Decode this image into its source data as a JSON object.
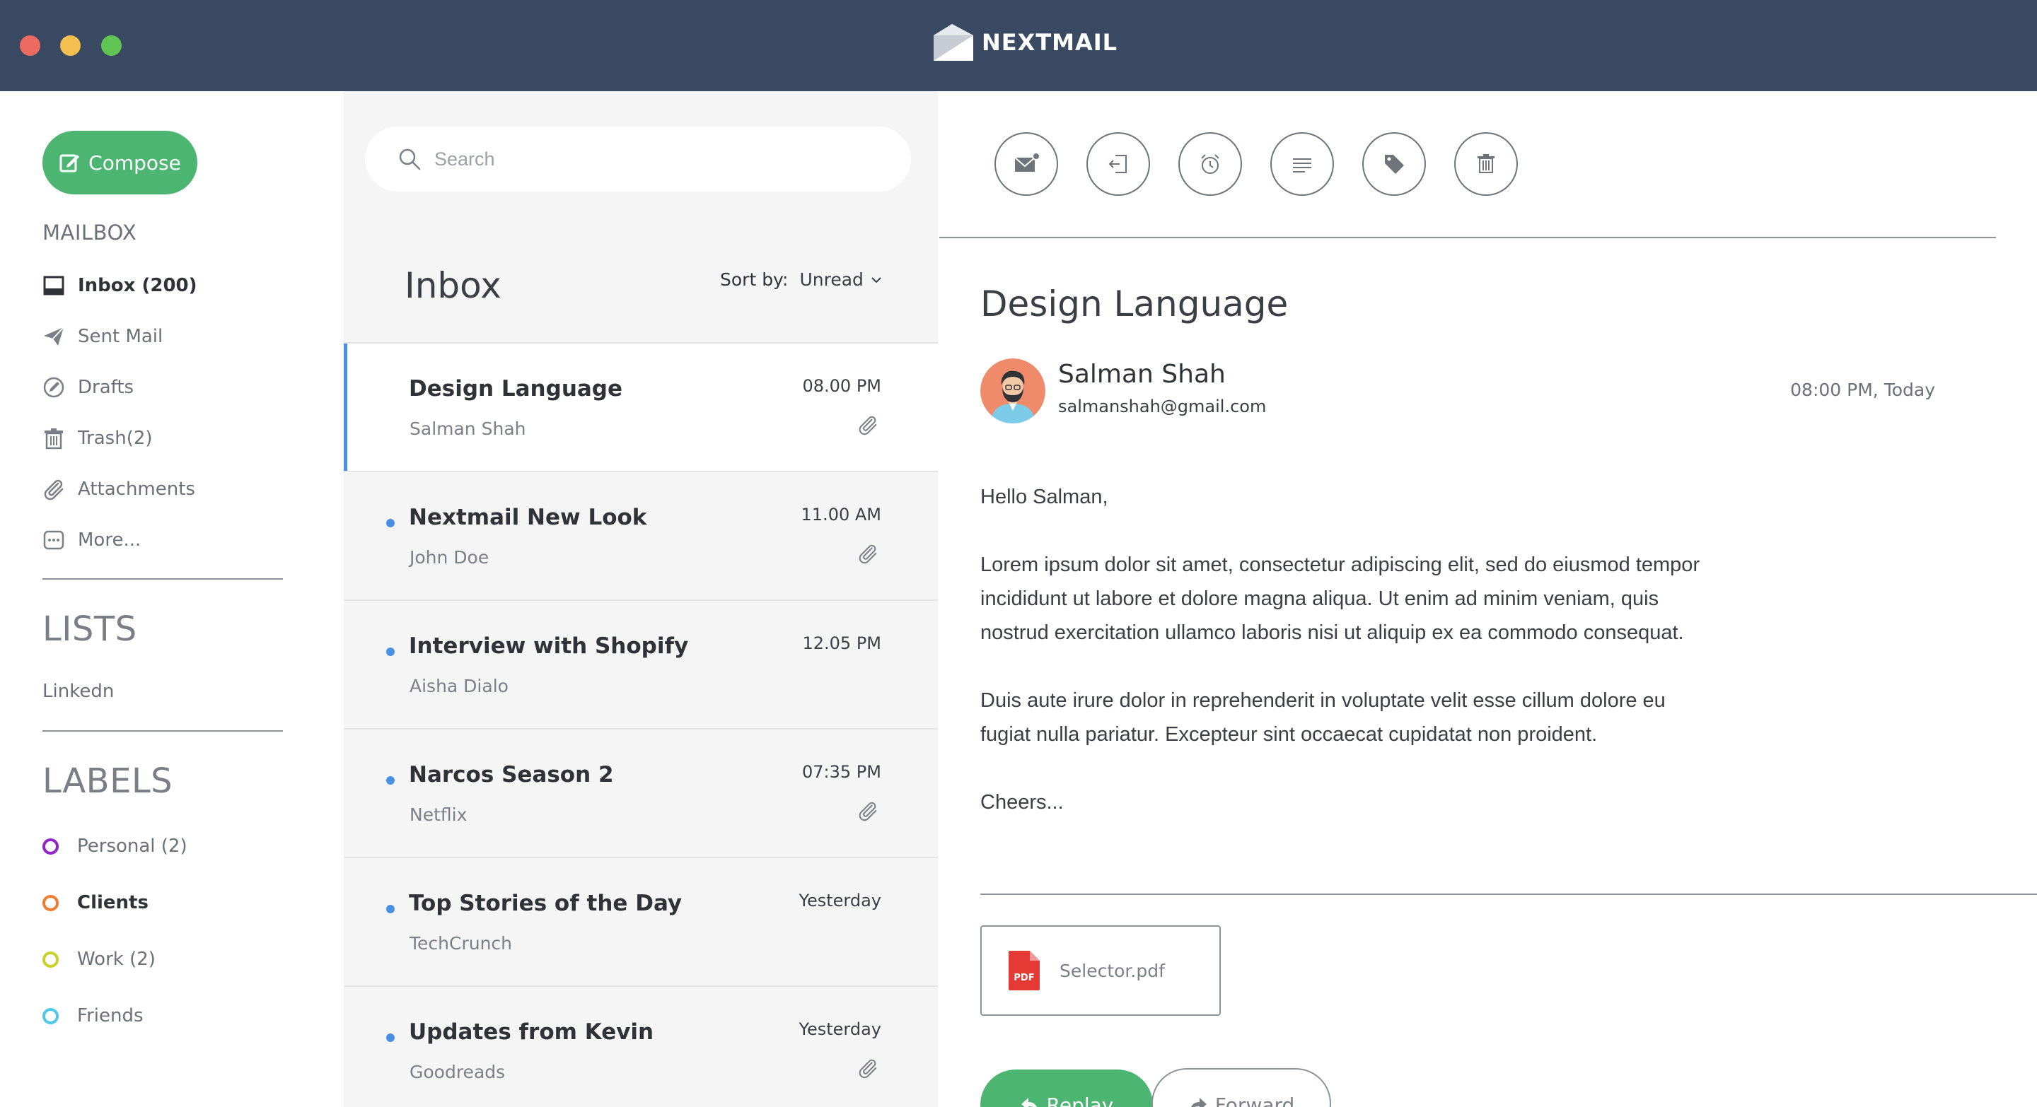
{
  "app": {
    "name": "NEXTMAIL",
    "accent_color": "#4cb571",
    "titlebar_color": "#3a4a62",
    "selection_color": "#4a90e2"
  },
  "sidebar": {
    "compose_label": "Compose",
    "mailbox_heading": "MAILBOX",
    "mailbox_items": [
      {
        "label": "Inbox (200)",
        "icon": "inbox-icon",
        "active": true
      },
      {
        "label": "Sent Mail",
        "icon": "paper-plane-icon",
        "active": false
      },
      {
        "label": "Drafts",
        "icon": "pencil-circle-icon",
        "active": false
      },
      {
        "label": "Trash(2)",
        "icon": "trash-icon",
        "active": false
      },
      {
        "label": "Attachments",
        "icon": "paperclip-icon",
        "active": false
      },
      {
        "label": "More...",
        "icon": "more-dots-icon",
        "active": false
      }
    ],
    "lists_heading": "LISTS",
    "lists": [
      "Linkedn"
    ],
    "labels_heading": "LABELS",
    "labels": [
      {
        "label": "Personal (2)",
        "color": "#8e24c9"
      },
      {
        "label": "Clients",
        "color": "#ef7d2f"
      },
      {
        "label": "Work (2)",
        "color": "#c8d12a"
      },
      {
        "label": "Friends",
        "color": "#4fc8e8"
      }
    ]
  },
  "message_list": {
    "search_placeholder": "Search",
    "title": "Inbox",
    "sort_label": "Sort by:",
    "sort_value": "Unread",
    "messages": [
      {
        "subject": "Design Language",
        "sender": "Salman Shah",
        "time": "08.00 PM",
        "unread": false,
        "attachment": true,
        "selected": true
      },
      {
        "subject": "Nextmail New Look",
        "sender": "John Doe",
        "time": "11.00 AM",
        "unread": true,
        "attachment": true,
        "selected": false
      },
      {
        "subject": "Interview with Shopify",
        "sender": "Aisha Dialo",
        "time": "12.05 PM",
        "unread": true,
        "attachment": false,
        "selected": false
      },
      {
        "subject": "Narcos Season 2",
        "sender": "Netflix",
        "time": "07:35 PM",
        "unread": true,
        "attachment": true,
        "selected": false
      },
      {
        "subject": "Top Stories of the Day",
        "sender": "TechCrunch",
        "time": "Yesterday",
        "unread": true,
        "attachment": false,
        "selected": false
      },
      {
        "subject": "Updates from Kevin",
        "sender": "Goodreads",
        "time": "Yesterday",
        "unread": true,
        "attachment": true,
        "selected": false
      }
    ]
  },
  "reader": {
    "toolbar": [
      {
        "icon": "envelope-unread-icon"
      },
      {
        "icon": "move-to-icon"
      },
      {
        "icon": "alarm-clock-icon"
      },
      {
        "icon": "lines-icon"
      },
      {
        "icon": "tag-icon"
      },
      {
        "icon": "trash-icon"
      }
    ],
    "subject": "Design Language",
    "sender_name": "Salman Shah",
    "sender_email": "salmanshah@gmail.com",
    "time": "08:00 PM, Today",
    "body": [
      "Hello Salman,",
      "Lorem ipsum dolor sit amet, consectetur adipiscing elit, sed do eiusmod tempor incididunt ut labore et dolore magna aliqua. Ut enim ad minim veniam, quis nostrud exercitation ullamco laboris nisi ut aliquip ex ea commodo consequat.",
      "Duis aute irure dolor in reprehenderit in voluptate velit esse cillum dolore eu fugiat nulla pariatur. Excepteur sint occaecat cupidatat non proident.",
      "Cheers..."
    ],
    "attachment_name": "Selector.pdf",
    "attachment_icon_text": "PDF",
    "reply_label": "Replay",
    "forward_label": "Forward"
  }
}
